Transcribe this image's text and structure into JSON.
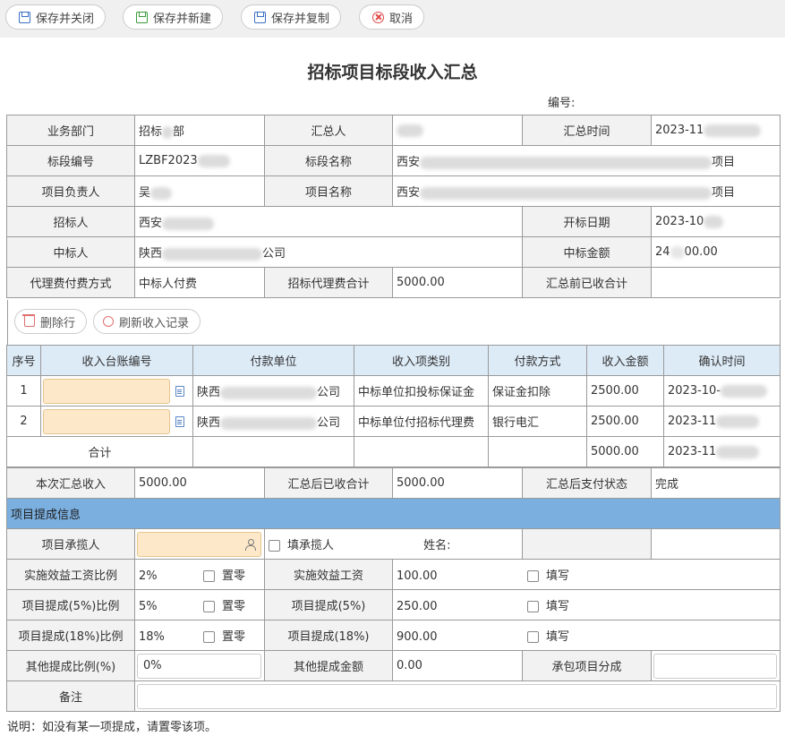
{
  "toolbar": {
    "save_close": "保存并关闭",
    "save_new": "保存并新建",
    "save_copy": "保存并复制",
    "cancel": "取消"
  },
  "page_title": "招标项目标段收入汇总",
  "doc_no_label": "编号:",
  "info": {
    "dept_label": "业务部门",
    "dept_value_a": "招标",
    "dept_value_b": "部",
    "summarizer_label": "汇总人",
    "summary_time_label": "汇总时间",
    "summary_time_value": "2023-11",
    "section_no_label": "标段编号",
    "section_no_value": "LZBF2023",
    "section_name_label": "标段名称",
    "section_name_value_a": "西安",
    "section_name_value_b": "项目",
    "pm_label": "项目负责人",
    "pm_value": "吴",
    "project_name_label": "项目名称",
    "project_name_value_a": "西安",
    "project_name_value_b": "项目",
    "tenderer_label": "招标人",
    "tenderer_value": "西安",
    "open_date_label": "开标日期",
    "open_date_value": "2023-10",
    "winner_label": "中标人",
    "winner_value_a": "陕西",
    "winner_value_b": "公司",
    "win_amount_label": "中标金额",
    "win_amount_value_a": "24",
    "win_amount_value_b": "00.00",
    "fee_method_label": "代理费付费方式",
    "fee_method_value": "中标人付费",
    "fee_total_label": "招标代理费合计",
    "fee_total_value": "5000.00",
    "pre_received_label": "汇总前已收合计",
    "pre_received_value": ""
  },
  "actions": {
    "delete_row": "删除行",
    "refresh": "刷新收入记录"
  },
  "income_table": {
    "headers": [
      "序号",
      "收入台账编号",
      "付款单位",
      "收入项类别",
      "付款方式",
      "收入金额",
      "确认时间"
    ],
    "rows": [
      {
        "no": "1",
        "ledger_no": "",
        "payer_a": "陕西",
        "payer_b": "公司",
        "category": "中标单位扣投标保证金",
        "method": "保证金扣除",
        "amount": "2500.00",
        "confirm_time": "2023-10-"
      },
      {
        "no": "2",
        "ledger_no": "",
        "payer_a": "陕西",
        "payer_b": "公司",
        "category": "中标单位付招标代理费",
        "method": "银行电汇",
        "amount": "2500.00",
        "confirm_time": "2023-11"
      }
    ],
    "total_label": "合计",
    "total_amount": "5000.00",
    "total_time": "2023-11"
  },
  "summary": {
    "this_income_label": "本次汇总收入",
    "this_income_value": "5000.00",
    "post_received_label": "汇总后已收合计",
    "post_received_value": "5000.00",
    "pay_status_label": "汇总后支付状态",
    "pay_status_value": "完成"
  },
  "commission": {
    "section_title": "项目提成信息",
    "contractor_label": "项目承揽人",
    "fill_contractor_label": "填承揽人",
    "name_label": "姓名:",
    "impl_ratio_label": "实施效益工资比例",
    "impl_ratio_value": "2%",
    "zero_label": "置零",
    "impl_wage_label": "实施效益工资",
    "impl_wage_value": "100.00",
    "fill_label": "填写",
    "p5_ratio_label": "项目提成(5%)比例",
    "p5_ratio_value": "5%",
    "p5_label": "项目提成(5%)",
    "p5_value": "250.00",
    "p18_ratio_label": "项目提成(18%)比例",
    "p18_ratio_value": "18%",
    "p18_label": "项目提成(18%)",
    "p18_value": "900.00",
    "other_ratio_label": "其他提成比例(%)",
    "other_ratio_value": "0%",
    "other_amount_label": "其他提成金额",
    "other_amount_value": "0.00",
    "contract_share_label": "承包项目分成",
    "remark_label": "备注"
  },
  "note": "说明：如没有某一项提成，请置零该项。"
}
